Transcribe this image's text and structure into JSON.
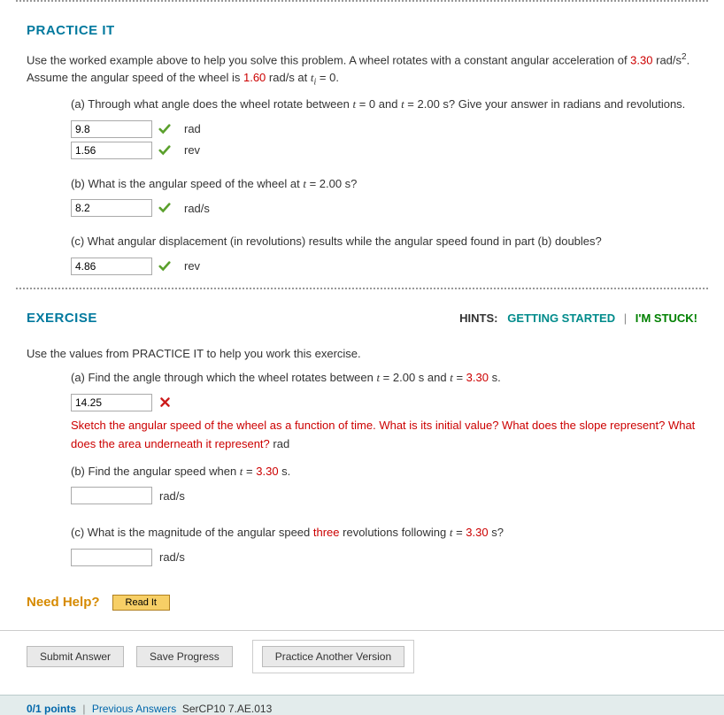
{
  "practice": {
    "title": "PRACTICE IT",
    "intro_pre": "Use the worked example above to help you solve this problem. A wheel rotates with a constant angular acceleration of ",
    "accel": "3.30",
    "intro_mid": " rad/s",
    "intro_post": ". Assume the angular speed of the wheel is ",
    "omega0": "1.60",
    "intro_end": " rad/s at ",
    "t_sub": "i",
    "intro_tail": " = 0.",
    "a": {
      "q": "(a) Through what angle does the wheel rotate between ",
      "q_mid": " = 0 and ",
      "q_end": " = 2.00 s? Give your answer in radians and revolutions.",
      "ans_rad": "9.8",
      "unit_rad": "rad",
      "ans_rev": "1.56",
      "unit_rev": "rev"
    },
    "b": {
      "q": "(b) What is the angular speed of the wheel at ",
      "q_end": " = 2.00 s?",
      "ans": "8.2",
      "unit": "rad/s"
    },
    "c": {
      "q": "(c) What angular displacement (in revolutions) results while the angular speed found in part (b) doubles?",
      "ans": "4.86",
      "unit": "rev"
    }
  },
  "exercise": {
    "title": "EXERCISE",
    "hints_label": "HINTS:",
    "getting_started": "GETTING STARTED",
    "im_stuck": "I'M STUCK!",
    "intro": "Use the values from PRACTICE IT to help you work this exercise.",
    "a": {
      "q_pre": "(a) Find the angle through which the wheel rotates between ",
      "q_mid": " = 2.00 s and ",
      "q_t2": "3.30",
      "q_end": " s.",
      "ans": "14.25",
      "feedback": "Sketch the angular speed of the wheel as a function of time. What is its initial value? What does the slope represent? What does the area underneath it represent?",
      "unit_after_feedback": " rad"
    },
    "b": {
      "q_pre": "(b) Find the angular speed when ",
      "q_t": "3.30",
      "q_end": " s.",
      "ans": "",
      "unit": "rad/s"
    },
    "c": {
      "q_pre": "(c) What is the magnitude of the angular speed ",
      "q_hi": "three",
      "q_mid": " revolutions following ",
      "q_t": "3.30",
      "q_end": " s?",
      "ans": "",
      "unit": "rad/s"
    }
  },
  "help": {
    "label": "Need Help?",
    "readit": "Read It"
  },
  "buttons": {
    "submit": "Submit Answer",
    "save": "Save Progress",
    "pav": "Practice Another Version"
  },
  "footer": {
    "points": "0/1 points",
    "prev": "Previous Answers",
    "code": "SerCP10 7.AE.013"
  }
}
